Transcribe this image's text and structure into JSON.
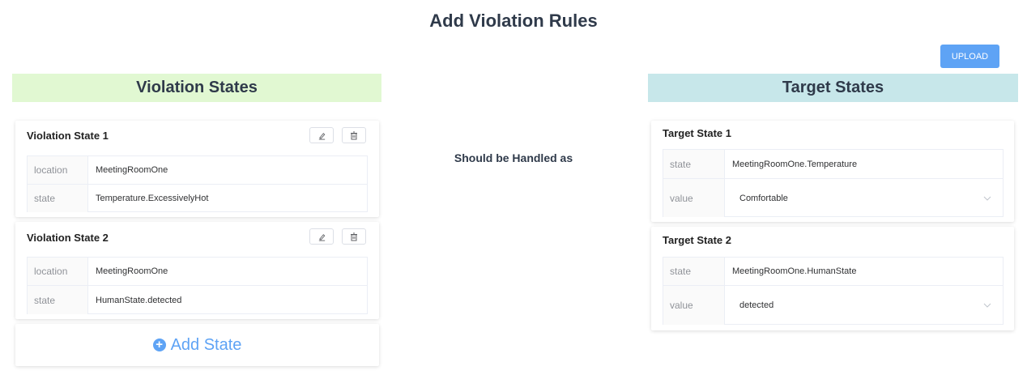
{
  "header": {
    "title": "Add Violation Rules",
    "upload_label": "UPLOAD"
  },
  "left_column": {
    "title": "Violation States",
    "cards": [
      {
        "title": "Violation State 1",
        "rows": [
          {
            "key": "location",
            "value": "MeetingRoomOne"
          },
          {
            "key": "state",
            "value": "Temperature.ExcessivelyHot"
          }
        ]
      },
      {
        "title": "Violation State 2",
        "rows": [
          {
            "key": "location",
            "value": "MeetingRoomOne"
          },
          {
            "key": "state",
            "value": "HumanState.detected"
          }
        ]
      }
    ],
    "add_label": "Add State"
  },
  "middle": {
    "text": "Should be Handled as"
  },
  "right_column": {
    "title": "Target States",
    "cards": [
      {
        "title": "Target State 1",
        "rows": [
          {
            "key": "state",
            "value": "MeetingRoomOne.Temperature"
          },
          {
            "key": "value",
            "value": "Comfortable"
          }
        ]
      },
      {
        "title": "Target State 2",
        "rows": [
          {
            "key": "state",
            "value": "MeetingRoomOne.HumanState"
          },
          {
            "key": "value",
            "value": "detected"
          }
        ]
      }
    ]
  },
  "icons": {
    "edit": "edit-icon",
    "delete": "trash-icon",
    "add": "plus-circle-icon",
    "dropdown": "chevron-down-icon"
  },
  "colors": {
    "accent": "#5ea3f5",
    "violation_header": "#e1f8d2",
    "target_header": "#c7e7ea"
  }
}
